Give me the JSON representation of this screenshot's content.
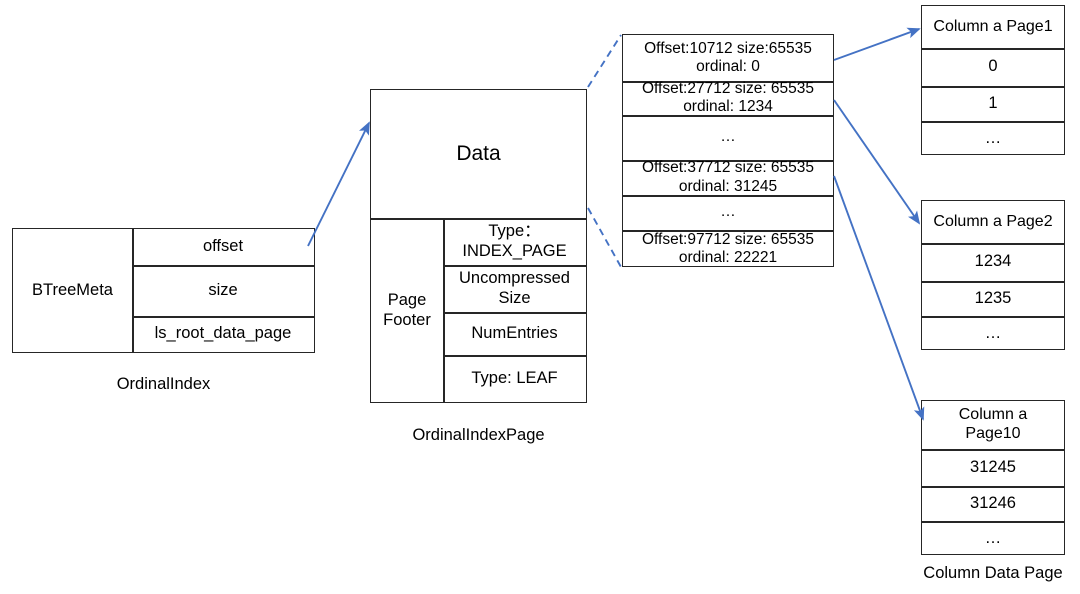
{
  "diagram": {
    "accent_color": "#4472C4",
    "line_color": "#262626"
  },
  "ordinal_index": {
    "caption": "OrdinalIndex",
    "label": "BTreeMeta",
    "fields": [
      "offset",
      "size",
      "ls_root_data_page"
    ]
  },
  "ordinal_index_page": {
    "caption": "OrdinalIndexPage",
    "data_label": "Data",
    "footer_label": "Page\nFooter",
    "footer_fields": [
      "Type：\nINDEX_PAGE",
      "Uncompressed\nSize",
      "NumEntries",
      "Type: LEAF"
    ]
  },
  "offset_entries": {
    "rows": [
      "Offset:10712 size:65535\nordinal: 0",
      "Offset:27712 size: 65535\nordinal: 1234",
      "…",
      "Offset:37712 size: 65535\nordinal: 31245",
      "…",
      "Offset:97712 size: 65535\nordinal: 22221"
    ]
  },
  "column_data_pages": {
    "caption": "Column Data Page",
    "pages": [
      {
        "header": "Column a Page1",
        "values": [
          "0",
          "1",
          "…"
        ]
      },
      {
        "header": "Column a Page2",
        "values": [
          "1234",
          "1235",
          "…"
        ]
      },
      {
        "header": "Column a\nPage10",
        "values": [
          "31245",
          "31246",
          "…"
        ]
      }
    ]
  }
}
